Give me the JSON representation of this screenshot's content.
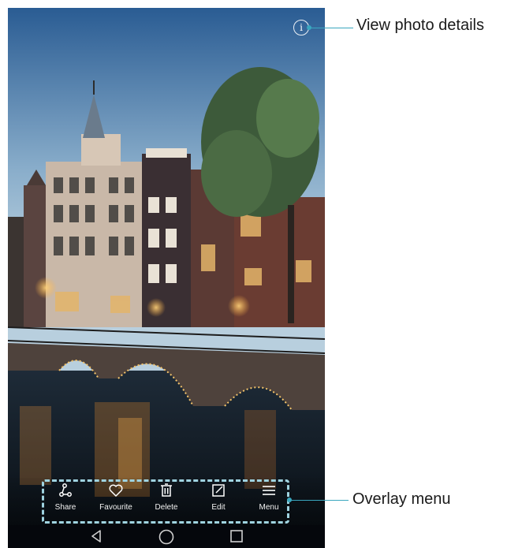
{
  "photo": {
    "subject": "Amsterdam canal houses and bridge at dusk"
  },
  "callouts": {
    "details": "View photo details",
    "menu": "Overlay menu"
  },
  "menu": {
    "items": [
      {
        "label": "Share",
        "icon": "share-icon"
      },
      {
        "label": "Favourite",
        "icon": "heart-icon"
      },
      {
        "label": "Delete",
        "icon": "trash-icon"
      },
      {
        "label": "Edit",
        "icon": "edit-icon"
      },
      {
        "label": "Menu",
        "icon": "menu-icon"
      }
    ]
  },
  "navigation": {
    "buttons": [
      "back",
      "home",
      "recents"
    ]
  },
  "colors": {
    "callout_line": "#3aa7bf",
    "dashed_outline": "#9fd3e0"
  }
}
